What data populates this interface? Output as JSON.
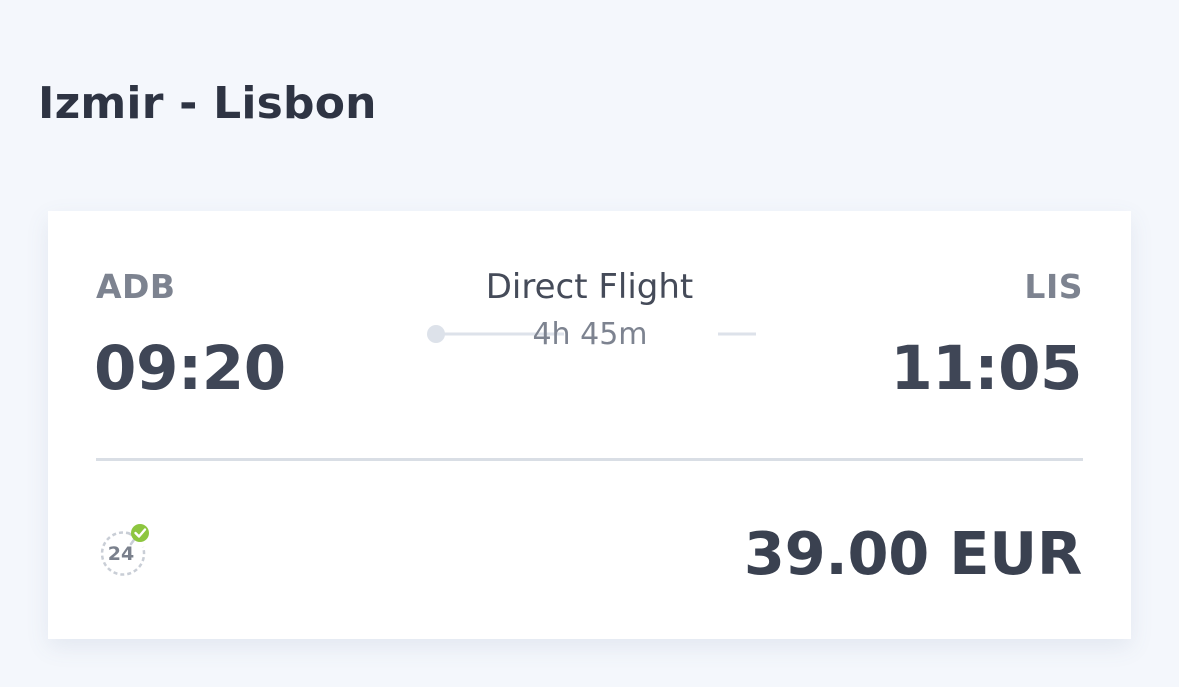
{
  "route": {
    "title": "Izmir - Lisbon"
  },
  "flight": {
    "departure": {
      "code": "ADB",
      "time": "09:20"
    },
    "arrival": {
      "code": "LIS",
      "time": "11:05"
    },
    "type": "Direct Flight",
    "duration": "4h 45m"
  },
  "fare": {
    "refund_badge_number": "24",
    "price": "39.00 EUR"
  },
  "icons": {
    "refund": "24h-refund-check-icon",
    "timeline_start": "dot-icon",
    "timeline_end": "arrow-right-icon"
  },
  "colors": {
    "background": "#f4f7fc",
    "card": "#ffffff",
    "text_dark": "#3f4656",
    "text_muted": "#7d8390",
    "check_green": "#8dc63f"
  }
}
